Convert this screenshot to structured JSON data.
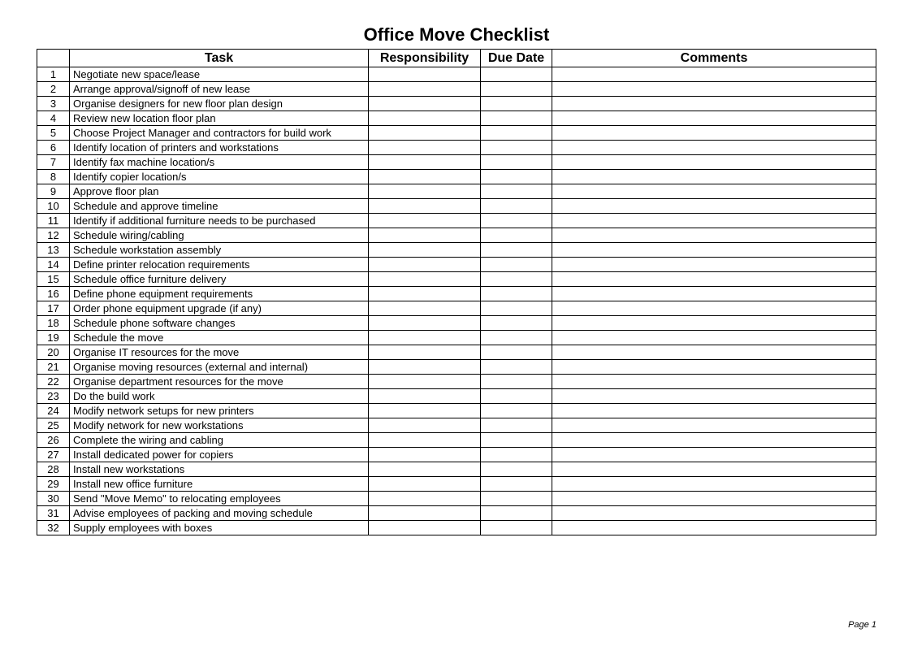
{
  "title": "Office Move Checklist",
  "columns": {
    "num": "",
    "task": "Task",
    "responsibility": "Responsibility",
    "due": "Due Date",
    "comments": "Comments"
  },
  "rows": [
    {
      "n": "1",
      "task": "Negotiate new space/lease",
      "responsibility": "",
      "due": "",
      "comments": ""
    },
    {
      "n": "2",
      "task": "Arrange approval/signoff of new lease",
      "responsibility": "",
      "due": "",
      "comments": ""
    },
    {
      "n": "3",
      "task": "Organise designers for new floor plan design",
      "responsibility": "",
      "due": "",
      "comments": ""
    },
    {
      "n": "4",
      "task": "Review new location floor plan",
      "responsibility": "",
      "due": "",
      "comments": ""
    },
    {
      "n": "5",
      "task": "Choose Project Manager and contractors for build work",
      "responsibility": "",
      "due": "",
      "comments": ""
    },
    {
      "n": "6",
      "task": "Identify location of printers and workstations",
      "responsibility": "",
      "due": "",
      "comments": ""
    },
    {
      "n": "7",
      "task": "Identify fax machine location/s",
      "responsibility": "",
      "due": "",
      "comments": ""
    },
    {
      "n": "8",
      "task": "Identify copier location/s",
      "responsibility": "",
      "due": "",
      "comments": ""
    },
    {
      "n": "9",
      "task": "Approve floor plan",
      "responsibility": "",
      "due": "",
      "comments": ""
    },
    {
      "n": "10",
      "task": "Schedule and approve timeline",
      "responsibility": "",
      "due": "",
      "comments": ""
    },
    {
      "n": "11",
      "task": "Identify if additional furniture needs to be purchased",
      "responsibility": "",
      "due": "",
      "comments": ""
    },
    {
      "n": "12",
      "task": "Schedule wiring/cabling",
      "responsibility": "",
      "due": "",
      "comments": ""
    },
    {
      "n": "13",
      "task": "Schedule workstation assembly",
      "responsibility": "",
      "due": "",
      "comments": ""
    },
    {
      "n": "14",
      "task": "Define printer relocation requirements",
      "responsibility": "",
      "due": "",
      "comments": ""
    },
    {
      "n": "15",
      "task": "Schedule office furniture delivery",
      "responsibility": "",
      "due": "",
      "comments": ""
    },
    {
      "n": "16",
      "task": "Define phone equipment requirements",
      "responsibility": "",
      "due": "",
      "comments": ""
    },
    {
      "n": "17",
      "task": "Order phone equipment upgrade (if any)",
      "responsibility": "",
      "due": "",
      "comments": ""
    },
    {
      "n": "18",
      "task": "Schedule phone software changes",
      "responsibility": "",
      "due": "",
      "comments": ""
    },
    {
      "n": "19",
      "task": "Schedule the move",
      "responsibility": "",
      "due": "",
      "comments": ""
    },
    {
      "n": "20",
      "task": "Organise IT resources for the move",
      "responsibility": "",
      "due": "",
      "comments": ""
    },
    {
      "n": "21",
      "task": "Organise moving resources (external and internal)",
      "responsibility": "",
      "due": "",
      "comments": ""
    },
    {
      "n": "22",
      "task": "Organise department resources for the move",
      "responsibility": "",
      "due": "",
      "comments": ""
    },
    {
      "n": "23",
      "task": "Do the build work",
      "responsibility": "",
      "due": "",
      "comments": ""
    },
    {
      "n": "24",
      "task": "Modify network setups for new printers",
      "responsibility": "",
      "due": "",
      "comments": ""
    },
    {
      "n": "25",
      "task": "Modify network for new workstations",
      "responsibility": "",
      "due": "",
      "comments": ""
    },
    {
      "n": "26",
      "task": "Complete the wiring and cabling",
      "responsibility": "",
      "due": "",
      "comments": ""
    },
    {
      "n": "27",
      "task": "Install dedicated power for copiers",
      "responsibility": "",
      "due": "",
      "comments": ""
    },
    {
      "n": "28",
      "task": "Install new workstations",
      "responsibility": "",
      "due": "",
      "comments": ""
    },
    {
      "n": "29",
      "task": "Install new office furniture",
      "responsibility": "",
      "due": "",
      "comments": ""
    },
    {
      "n": "30",
      "task": "Send \"Move Memo\" to relocating employees",
      "responsibility": "",
      "due": "",
      "comments": ""
    },
    {
      "n": "31",
      "task": "Advise employees of packing and moving schedule",
      "responsibility": "",
      "due": "",
      "comments": ""
    },
    {
      "n": "32",
      "task": "Supply employees with boxes",
      "responsibility": "",
      "due": "",
      "comments": ""
    }
  ],
  "footer": "Page 1"
}
